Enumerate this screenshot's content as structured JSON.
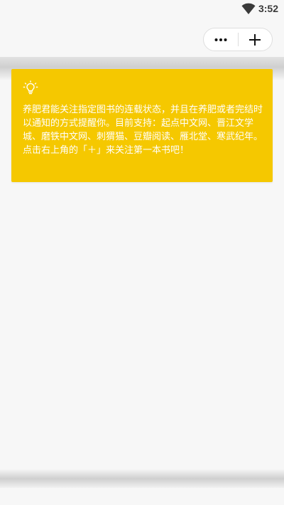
{
  "status_bar": {
    "wifi_icon": "wifi-icon",
    "time": "3:52"
  },
  "capsule": {
    "more_icon": "more-dots-icon",
    "add_icon": "plus-icon"
  },
  "notice": {
    "icon": "lightbulb-icon",
    "line1": "养肥君能关注指定图书的连载状态，并且在养肥或者完结时以通知的方式提醒你。目前支持：起点中文网、晋江文学城、磨铁中文网、刺猬猫、豆瓣阅读、雁北堂、寒武纪年。",
    "line2": "点击右上角的「＋」来关注第一本书吧！",
    "background_color": "#f5c800",
    "text_color": "#ffffff"
  }
}
